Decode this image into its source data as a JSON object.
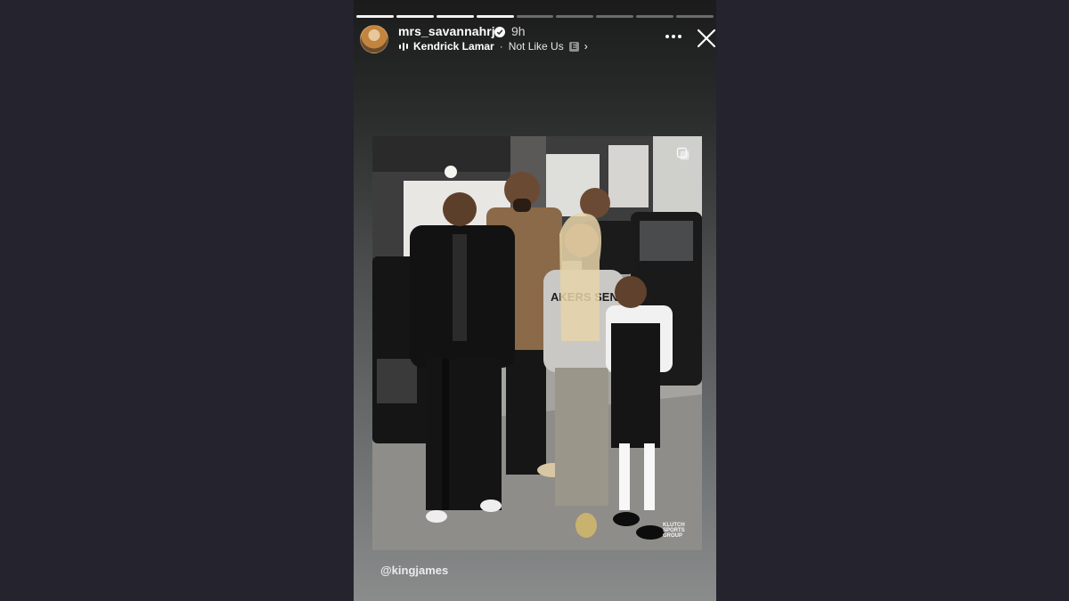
{
  "story": {
    "username": "mrs_savannahrj",
    "time_ago": "9h",
    "music": {
      "artist": "Kendrick Lamar",
      "separator": "·",
      "track": "Not Like Us",
      "explicit_badge": "E",
      "chevron": "›"
    },
    "progress_segments": 9,
    "current_segment": 4,
    "mention": "@kingjames",
    "photo_watermark": "KLUTCH SPORTS GROUP",
    "photo_hoodie_text": "AKERS SENTIALS"
  },
  "icons": {
    "verified": "verified-badge-icon",
    "more": "more-options-icon",
    "close": "close-icon",
    "music": "music-bars-icon",
    "copy": "multi-photo-icon"
  },
  "colors": {
    "page_background": "#24232e",
    "text": "#ffffff"
  }
}
